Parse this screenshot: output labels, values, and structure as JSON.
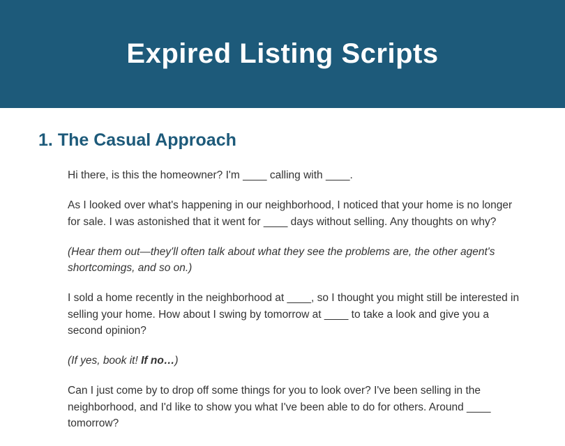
{
  "header": {
    "title": "Expired Listing Scripts"
  },
  "section": {
    "number": "1.",
    "title": "The Casual Approach"
  },
  "paragraphs": {
    "p1": "Hi there, is this the homeowner? I'm ____ calling with ____.",
    "p2": "As I looked over what's happening in our neighborhood, I noticed that your home is no longer for sale. I was astonished that it went for ____ days without selling. Any thoughts on why?",
    "p3": "(Hear them out—they'll often talk about what they see the problems are, the other agent's shortcomings, and so on.)",
    "p4": "I sold a home recently in the neighborhood at ____, so I thought you might still be interested in selling your home. How about I swing by tomorrow at ____ to take a look and give you a second opinion?",
    "p5_prefix": "(If yes, book it! ",
    "p5_bold": "If no…",
    "p5_suffix": ")",
    "p6": "Can I just come by to drop off some things for you to look over? I've been selling in the neighborhood, and I'd like to show you what I've been able to do for others. Around ____ tomorrow?"
  }
}
